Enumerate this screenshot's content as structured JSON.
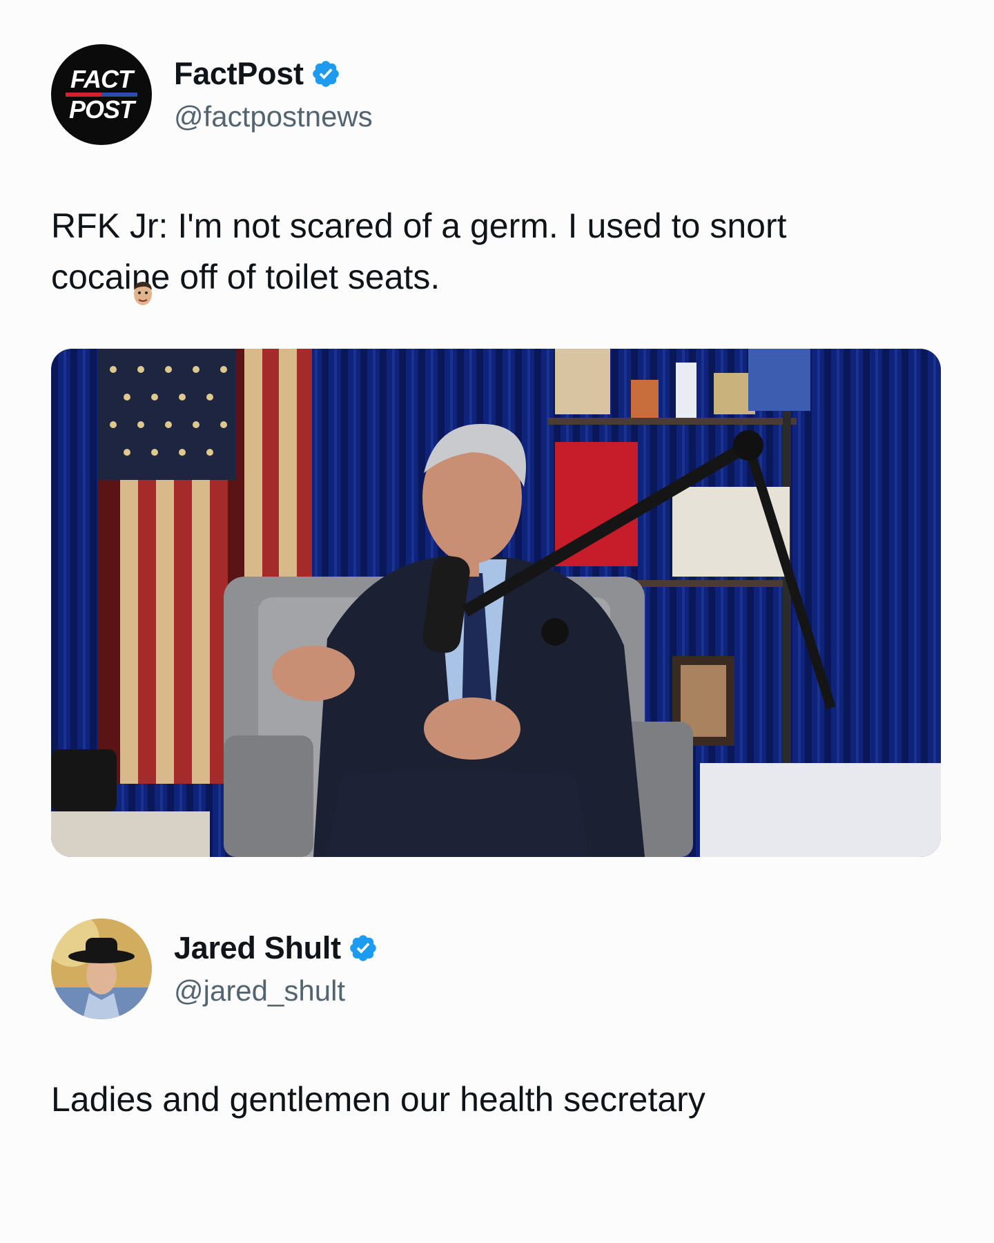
{
  "tweets": [
    {
      "display_name": "FactPost",
      "handle": "@factpostnews",
      "verified": true,
      "avatar_logo": {
        "line1": "FACT",
        "line2": "POST"
      },
      "text_line1": "RFK Jr: I'm not scared of a germ. I used to snort",
      "text_line2": "cocaine off of toilet seats.",
      "media": {
        "kind": "video-still"
      }
    },
    {
      "display_name": "Jared Shult",
      "handle": "@jared_shult",
      "verified": true,
      "text": "Ladies and gentlemen our health secretary"
    }
  ],
  "colors": {
    "verified": "#1d9bf0",
    "handle": "#536471",
    "text": "#0f1419",
    "background": "#fcfcfd"
  },
  "icons": [
    "verified-badge-icon"
  ]
}
